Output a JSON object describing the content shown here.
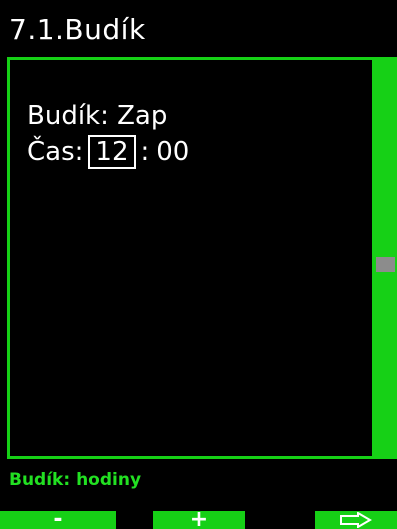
{
  "header": {
    "title": "7.1.Budík"
  },
  "content": {
    "alarm_label": "Budík:",
    "alarm_value": "Zap",
    "time_label": "Čas:",
    "time_hour": "12",
    "time_separator": ":",
    "time_minute": "00"
  },
  "status": {
    "hint": "Budík: hodiny"
  },
  "softkeys": {
    "minus": "-",
    "plus": "+",
    "next_icon": "right-arrow-icon"
  },
  "colors": {
    "background": "#000000",
    "accent_green": "#16d016",
    "text": "#ffffff",
    "scroll_thumb": "#8c8c8c"
  }
}
